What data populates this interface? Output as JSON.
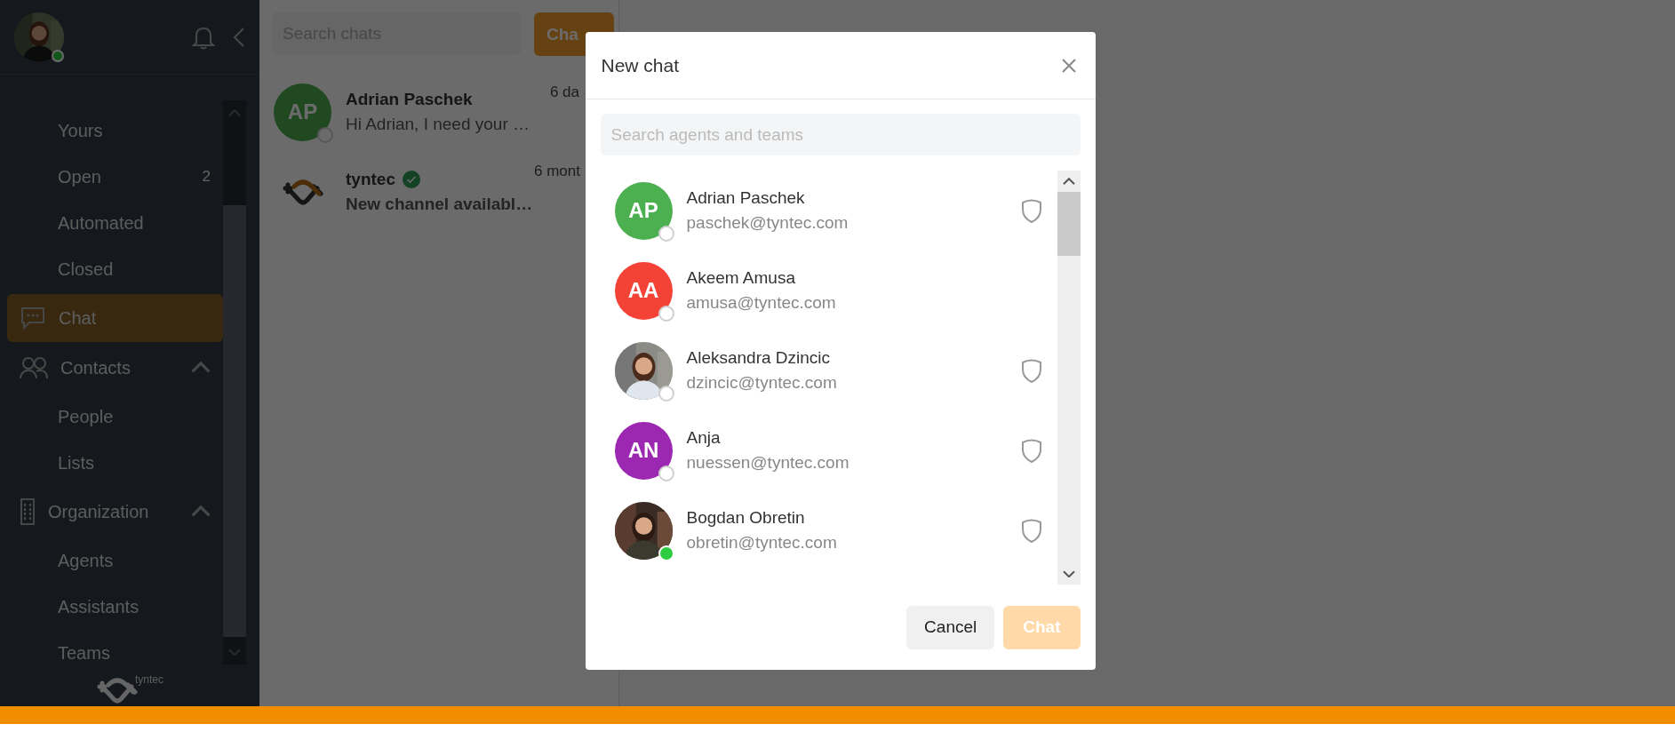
{
  "sidebar": {
    "user": {
      "online": true
    },
    "nav": [
      {
        "kind": "item",
        "label": "Yours",
        "selected": false
      },
      {
        "kind": "item",
        "label": "Open",
        "count": "2",
        "selected": false
      },
      {
        "kind": "item",
        "label": "Automated",
        "selected": false
      },
      {
        "kind": "item",
        "label": "Closed",
        "selected": false
      },
      {
        "kind": "section",
        "label": "Chat",
        "selected": true
      },
      {
        "kind": "section",
        "label": "Contacts",
        "selected": false,
        "expanded": true,
        "children": [
          {
            "label": "People",
            "selected": false
          },
          {
            "label": "Lists",
            "selected": false
          }
        ]
      },
      {
        "kind": "section",
        "label": "Organization",
        "selected": false,
        "expanded": true,
        "children": [
          {
            "label": "Agents",
            "selected": false
          },
          {
            "label": "Assistants",
            "selected": false
          },
          {
            "label": "Teams",
            "selected": false
          }
        ]
      }
    ],
    "brand": "tyntec"
  },
  "chat_list": {
    "search": {
      "placeholder": "Search chats"
    },
    "new_button": "Cha",
    "chats": [
      {
        "kind": "contact",
        "initials": "AP",
        "online": false,
        "name": "Adrian Paschek",
        "verified": false,
        "preview": "Hi Adrian, I need your …",
        "unread": false,
        "time": "6 da"
      },
      {
        "kind": "channel",
        "name": "tyntec",
        "verified": true,
        "preview": "New channel availabl…",
        "unread": true,
        "time": "6 mont"
      }
    ]
  },
  "modal": {
    "title": "New chat",
    "search": {
      "placeholder": "Search agents and teams"
    },
    "agents": [
      {
        "kind": "initials",
        "initials": "AP",
        "color": "#4caf50",
        "online": false,
        "name": "Adrian Paschek",
        "email": "paschek@tyntec.com",
        "admin": true
      },
      {
        "kind": "initials",
        "initials": "AA",
        "color": "#f44336",
        "online": false,
        "name": "Akeem Amusa",
        "email": "amusa@tyntec.com",
        "admin": false
      },
      {
        "online": false,
        "name": "Aleksandra Dzincic",
        "email": "dzincic@tyntec.com",
        "admin": true
      },
      {
        "kind": "initials",
        "initials": "AN",
        "color": "#9c27b0",
        "online": false,
        "name": "Anja",
        "email": "nuessen@tyntec.com",
        "admin": true
      },
      {
        "online": true,
        "name": "Bogdan Obretin",
        "email": "obretin@tyntec.com",
        "admin": true
      }
    ],
    "buttons": [
      {
        "kind": "secondary",
        "label": "Cancel",
        "disabled": false
      },
      {
        "kind": "primary",
        "label": "Chat",
        "disabled": true
      }
    ]
  }
}
